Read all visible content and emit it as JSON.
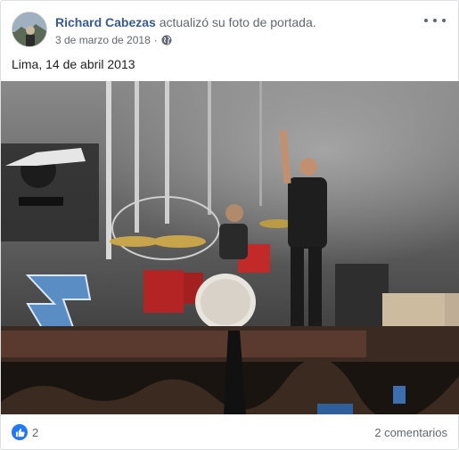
{
  "post": {
    "author": "Richard Cabezas",
    "action": "actualizó su foto de portada.",
    "date": "3 de marzo de 2018",
    "separator": "·",
    "privacy_icon": "globe-icon",
    "more_icon": "more-options-icon",
    "caption": "Lima, 14 de abril 2013"
  },
  "footer": {
    "reaction_icon": "like-icon",
    "reaction_count": "2",
    "comments": "2 comentarios"
  },
  "colors": {
    "author_link": "#385898",
    "muted_text": "#616770",
    "like_blue": "#2078f4"
  }
}
